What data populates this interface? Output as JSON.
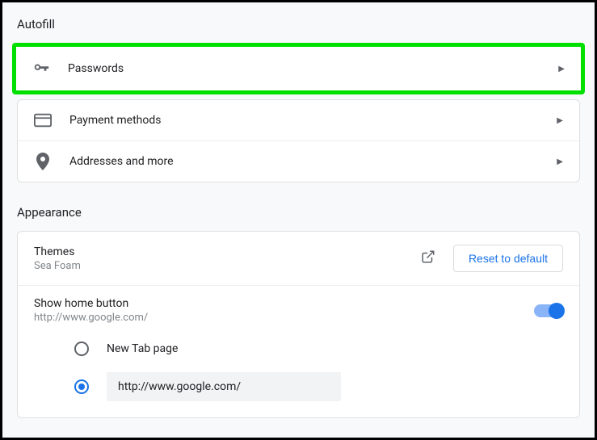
{
  "autofill": {
    "title": "Autofill",
    "items": [
      {
        "label": "Passwords"
      },
      {
        "label": "Payment methods"
      },
      {
        "label": "Addresses and more"
      }
    ]
  },
  "appearance": {
    "title": "Appearance",
    "themes": {
      "label": "Themes",
      "value": "Sea Foam",
      "reset_label": "Reset to default"
    },
    "home_button": {
      "label": "Show home button",
      "value": "http://www.google.com/",
      "options": {
        "newtab": "New Tab page",
        "custom_url": "http://www.google.com/"
      }
    }
  }
}
